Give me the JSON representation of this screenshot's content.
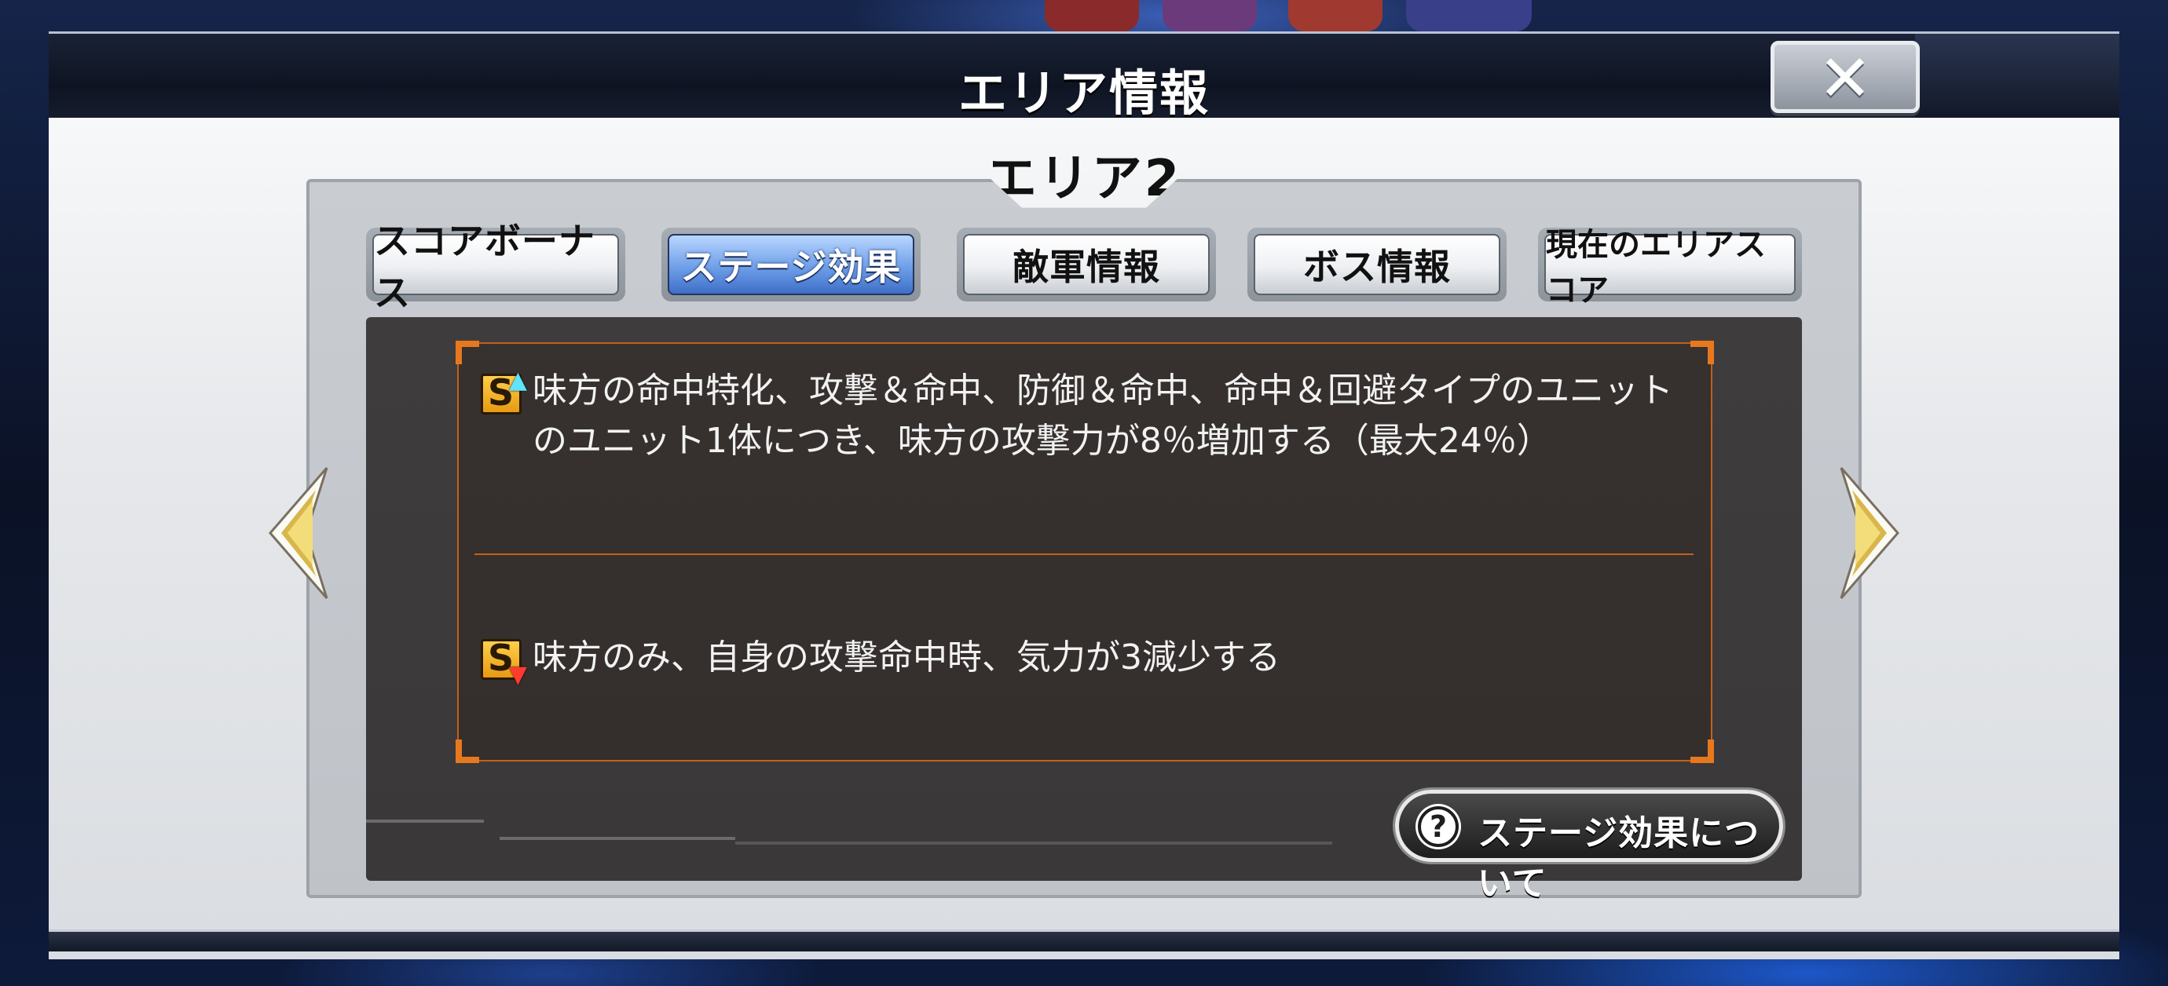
{
  "window": {
    "title": "エリア情報",
    "close_label": "✕"
  },
  "area": {
    "name": "エリア2"
  },
  "tabs": [
    {
      "label": "スコアボーナス",
      "active": false
    },
    {
      "label": "ステージ効果",
      "active": true
    },
    {
      "label": "敵軍情報",
      "active": false
    },
    {
      "label": "ボス情報",
      "active": false
    },
    {
      "label": "現在のエリアスコア",
      "active": false
    }
  ],
  "effects": [
    {
      "icon": "stage-buff-icon",
      "icon_letter": "S",
      "text": "味方の命中特化、攻撃＆命中、防御＆命中、命中＆回避タイプのユニットのユニット1体につき、味方の攻撃力が8％増加する（最大24％）"
    },
    {
      "icon": "stage-debuff-icon",
      "icon_letter": "S",
      "text": "味方のみ、自身の攻撃命中時、気力が3減少する"
    }
  ],
  "help_button": {
    "icon_glyph": "?",
    "label": "ステージ効果について"
  },
  "colors": {
    "active_tab": "#6e9fe8",
    "effect_border": "#c2611b",
    "content_bg": "#3f3c3d"
  }
}
